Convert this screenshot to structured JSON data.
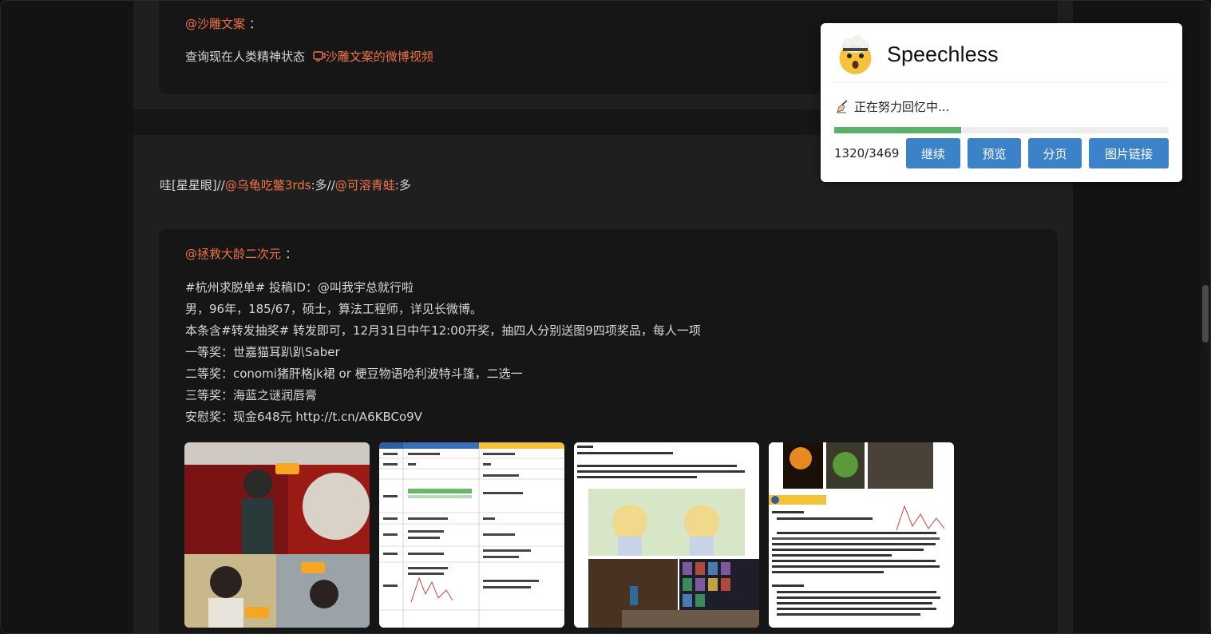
{
  "post1": {
    "author": "@沙雕文案",
    "colon": "：",
    "text": "查询现在人类精神状态",
    "video_link": "沙雕文案的微博视频"
  },
  "post2": {
    "header_prefix": "哇[星星眼]//",
    "mention1": "@乌龟吃鳖3rds",
    "mid": ":多//",
    "mention2": "@可溶青蛙",
    "suffix": ":多",
    "repost": {
      "author": "@拯救大龄二次元",
      "colon": "：",
      "lines": [
        "#杭州求脱单# 投稿ID：@叫我宇总就行啦",
        "男，96年，185/67，硕士，算法工程师，详见长微博。",
        "本条含#转发抽奖# 转发即可，12月31日中午12:00开奖，抽四人分别送图9四项奖品，每人一项",
        "一等奖：世嘉猫耳趴趴Saber",
        "二等奖：conomi猪肝格jk裙 or 梗豆物语哈利波特斗篷，二选一",
        "三等奖：海蓝之谜润唇膏",
        "安慰奖：现金648元 http://t.cn/A6KBCo9V"
      ]
    }
  },
  "popup": {
    "title": "Speechless",
    "status": "正在努力回忆中...",
    "progress_current": 1320,
    "progress_total": 3469,
    "count_text": "1320/3469",
    "buttons": [
      "继续",
      "预览",
      "分页",
      "图片链接"
    ]
  },
  "colors": {
    "accent_link": "#f07246",
    "button_blue": "#3b82c9",
    "progress_green": "#58b26a"
  }
}
